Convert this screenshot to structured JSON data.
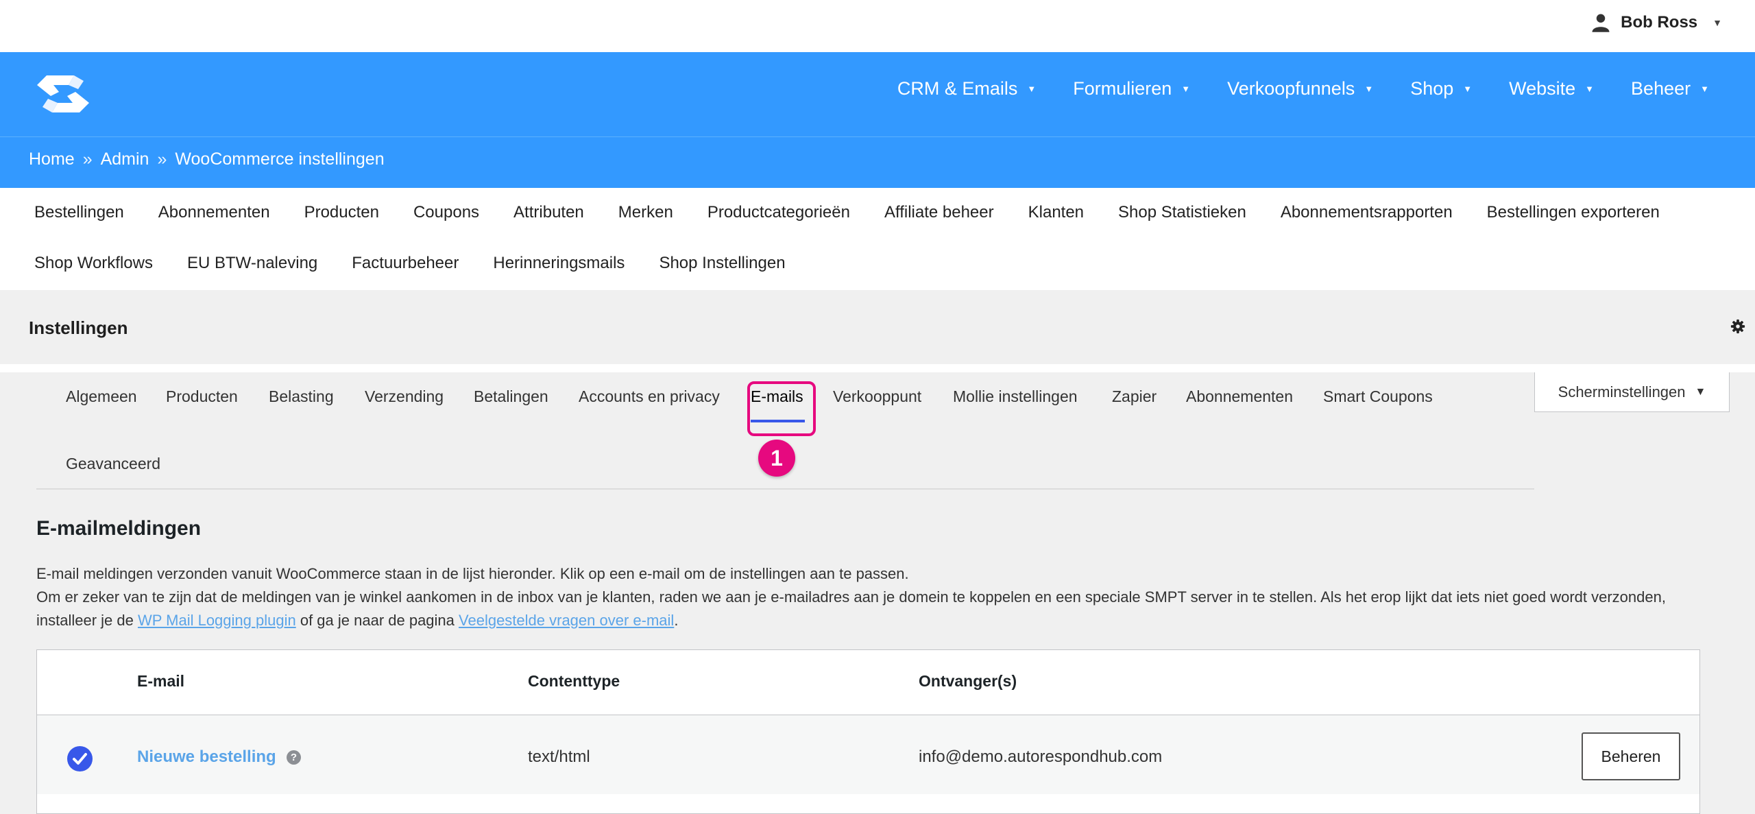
{
  "user": {
    "name": "Bob Ross",
    "icon": "user-icon"
  },
  "header": {
    "logo_icon": "autorespond-logo",
    "nav": [
      "CRM & Emails",
      "Formulieren",
      "Verkoopfunnels",
      "Shop",
      "Website",
      "Beheer"
    ],
    "accent": "#3399ff"
  },
  "breadcrumb": {
    "items": [
      "Home",
      "Admin",
      "WooCommerce instellingen"
    ],
    "separator": "»"
  },
  "submenu": {
    "row1": [
      "Bestellingen",
      "Abonnementen",
      "Producten",
      "Coupons",
      "Attributen",
      "Merken",
      "Productcategorieën",
      "Affiliate beheer",
      "Klanten",
      "Shop Statistieken",
      "Abonnementsrapporten",
      "Bestellingen exporteren"
    ],
    "row2": [
      "Shop Workflows",
      "EU BTW-naleving",
      "Factuurbeheer",
      "Herinneringsmails",
      "Shop Instellingen"
    ]
  },
  "settings": {
    "title": "Instellingen",
    "gear_icon": "gear-icon"
  },
  "screen_options": {
    "label": "Scherminstellingen",
    "caret": "▼"
  },
  "tabs": {
    "items": [
      "Algemeen",
      "Producten",
      "Belasting",
      "Verzending",
      "Betalingen",
      "Accounts en privacy",
      "E-mails",
      "Verkooppunt",
      "Mollie instellingen",
      "Zapier",
      "Abonnementen",
      "Smart Coupons",
      "Geavanceerd"
    ],
    "active": "E-mails",
    "annotation": "1",
    "annotation_color": "#e6097f"
  },
  "section": {
    "title": "E-mailmeldingen",
    "line1": "E-mail meldingen verzonden vanuit WooCommerce staan in de lijst hieronder. Klik op een e-mail om de instellingen aan te passen.",
    "line2_a": "Om er zeker van te zijn dat de meldingen van je winkel aankomen in de inbox van je klanten, raden we aan je e-mailadres aan je domein te koppelen en een speciale SMPT server in te stellen. Als het erop lijkt dat iets niet goed wordt verzonden, installeer je de ",
    "link1": "WP Mail Logging plugin",
    "line2_b": " of ga je naar de pagina ",
    "link2": "Veelgestelde vragen over e-mail",
    "line2_c": "."
  },
  "table": {
    "headers": [
      "E-mail",
      "Contenttype",
      "Ontvanger(s)"
    ],
    "rows": [
      {
        "enabled": true,
        "name": "Nieuwe bestelling",
        "help": "?",
        "content_type": "text/html",
        "recipient": "info@demo.autorespondhub.com",
        "action": "Beheren"
      }
    ]
  }
}
